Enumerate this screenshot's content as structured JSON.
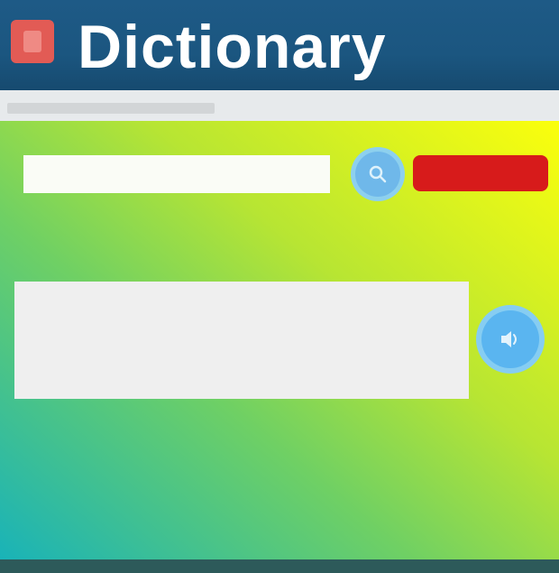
{
  "app": {
    "title": "Dictionary"
  },
  "search": {
    "value": "",
    "placeholder": ""
  },
  "buttons": {
    "clear_label": ""
  },
  "result": {
    "text": ""
  },
  "colors": {
    "header": "#1b5680",
    "clear_button": "#d71b1b",
    "circle_button": "#6fb8ea",
    "gradient_start": "#19b3b8",
    "gradient_end": "#fbff0c"
  },
  "icons": {
    "logo": "dictionary-logo-icon",
    "search": "search-icon",
    "speak": "speaker-icon"
  }
}
